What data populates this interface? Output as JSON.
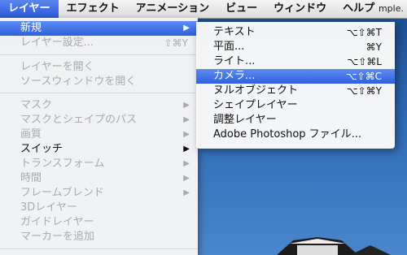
{
  "menubar": {
    "items": [
      "レイヤー",
      "エフェクト",
      "アニメーション",
      "ビュー",
      "ウィンドウ",
      "ヘルプ"
    ],
    "active_index": 0,
    "right_text": "mple."
  },
  "layer_menu": {
    "items": [
      {
        "label": "新規",
        "enabled": true,
        "highlight": true,
        "submenu": true,
        "shortcut": ""
      },
      {
        "label": "レイヤー設定...",
        "enabled": false,
        "submenu": false,
        "shortcut": "⇧⌘Y"
      },
      {
        "label": "レイヤーを開く",
        "enabled": false,
        "submenu": false,
        "shortcut": ""
      },
      {
        "label": "ソースウィンドウを開く",
        "enabled": false,
        "submenu": false,
        "shortcut": ""
      },
      {
        "label": "マスク",
        "enabled": false,
        "submenu": true,
        "shortcut": ""
      },
      {
        "label": "マスクとシェイプのパス",
        "enabled": false,
        "submenu": true,
        "shortcut": ""
      },
      {
        "label": "画質",
        "enabled": false,
        "submenu": true,
        "shortcut": ""
      },
      {
        "label": "スイッチ",
        "enabled": true,
        "submenu": true,
        "shortcut": ""
      },
      {
        "label": "トランスフォーム",
        "enabled": false,
        "submenu": true,
        "shortcut": ""
      },
      {
        "label": "時間",
        "enabled": false,
        "submenu": true,
        "shortcut": ""
      },
      {
        "label": "フレームブレンド",
        "enabled": false,
        "submenu": true,
        "shortcut": ""
      },
      {
        "label": "3Dレイヤー",
        "enabled": false,
        "submenu": false,
        "shortcut": ""
      },
      {
        "label": "ガイドレイヤー",
        "enabled": false,
        "submenu": false,
        "shortcut": ""
      },
      {
        "label": "マーカーを追加",
        "enabled": false,
        "submenu": false,
        "shortcut": ""
      }
    ],
    "arrow_glyph": "▶"
  },
  "new_submenu": {
    "items": [
      {
        "label": "テキスト",
        "shortcut": "⌥⇧⌘T",
        "highlight": false
      },
      {
        "label": "平面...",
        "shortcut": "⌘Y",
        "highlight": false
      },
      {
        "label": "ライト...",
        "shortcut": "⌥⇧⌘L",
        "highlight": false
      },
      {
        "label": "カメラ...",
        "shortcut": "⌥⇧⌘C",
        "highlight": true
      },
      {
        "label": "ヌルオブジェクト",
        "shortcut": "⌥⇧⌘Y",
        "highlight": false
      },
      {
        "label": "シェイプレイヤー",
        "shortcut": "",
        "highlight": false
      },
      {
        "label": "調整レイヤー",
        "shortcut": "",
        "highlight": false
      },
      {
        "label": "Adobe Photoshop ファイル...",
        "shortcut": "",
        "highlight": false
      }
    ]
  }
}
